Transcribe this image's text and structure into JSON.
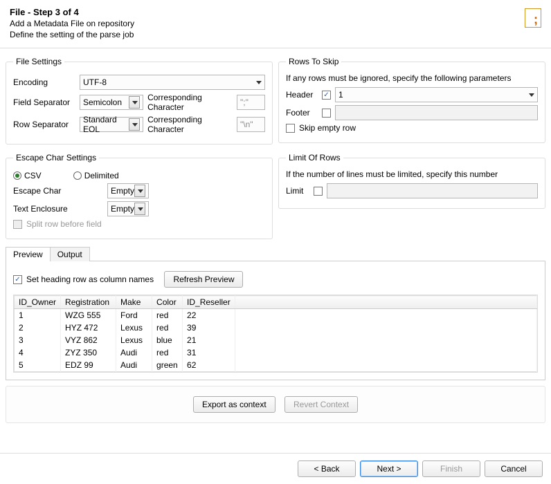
{
  "header": {
    "title": "File - Step 3 of 4",
    "line1": "Add a Metadata File on repository",
    "line2": "Define the setting of the parse job"
  },
  "fileSettings": {
    "legend": "File Settings",
    "encodingLabel": "Encoding",
    "encodingValue": "UTF-8",
    "fieldSepLabel": "Field Separator",
    "fieldSepValue": "Semicolon",
    "corrCharLabel": "Corresponding Character",
    "fieldSepChar": "\";\"",
    "rowSepLabel": "Row Separator",
    "rowSepValue": "Standard EOL",
    "rowSepChar": "\"\\n\""
  },
  "rowsToSkip": {
    "legend": "Rows To Skip",
    "hint": "If any rows must be ignored, specify the following parameters",
    "headerLabel": "Header",
    "headerValue": "1",
    "footerLabel": "Footer",
    "skipEmptyLabel": "Skip empty row"
  },
  "escape": {
    "legend": "Escape Char Settings",
    "csv": "CSV",
    "delimited": "Delimited",
    "escapeCharLabel": "Escape Char",
    "escapeCharValue": "Empty",
    "textEnclosureLabel": "Text Enclosure",
    "textEnclosureValue": "Empty",
    "splitRowLabel": "Split row before field"
  },
  "limit": {
    "legend": "Limit Of Rows",
    "hint": "If the number of lines must be limited, specify this number",
    "limitLabel": "Limit"
  },
  "tabs": {
    "preview": "Preview",
    "output": "Output"
  },
  "previewPane": {
    "headingCheckLabel": "Set heading row as column names",
    "refreshLabel": "Refresh Preview",
    "columns": [
      "ID_Owner",
      "Registration",
      "Make",
      "Color",
      "ID_Reseller"
    ],
    "rows": [
      [
        "1",
        "WZG 555",
        "Ford",
        "red",
        "22"
      ],
      [
        "2",
        "HYZ 472",
        "Lexus",
        "red",
        "39"
      ],
      [
        "3",
        "VYZ 862",
        "Lexus",
        "blue",
        "21"
      ],
      [
        "4",
        "ZYZ 350",
        "Audi",
        "red",
        "31"
      ],
      [
        "5",
        "EDZ 99",
        "Audi",
        "green",
        "62"
      ]
    ]
  },
  "contextButtons": {
    "export": "Export as context",
    "revert": "Revert Context"
  },
  "footerButtons": {
    "back": "< Back",
    "next": "Next >",
    "finish": "Finish",
    "cancel": "Cancel"
  }
}
